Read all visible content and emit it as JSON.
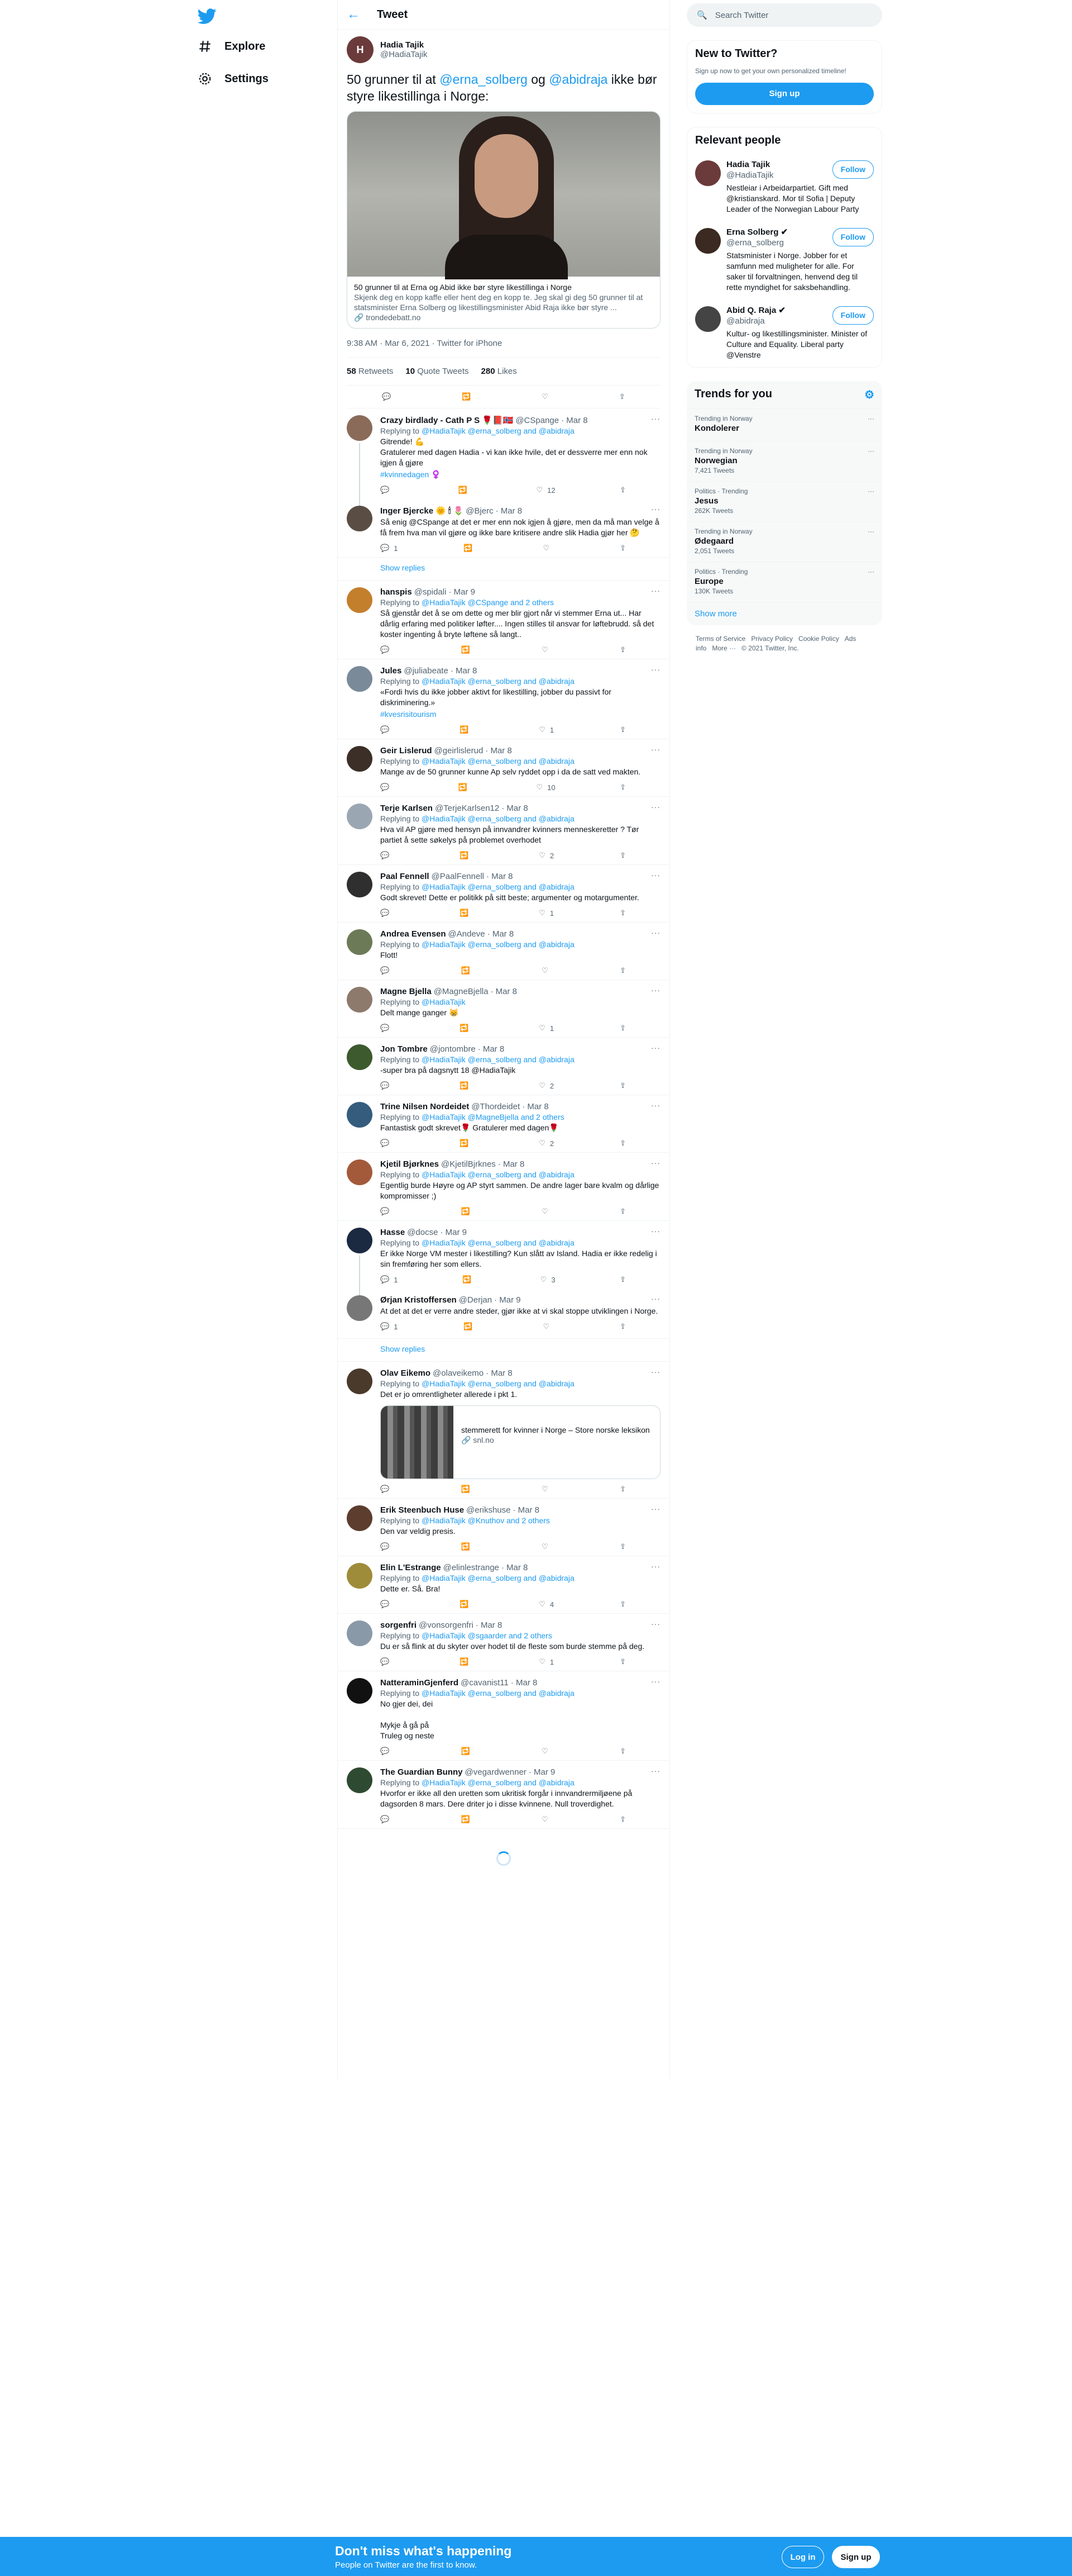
{
  "nav": {
    "explore": "Explore",
    "settings": "Settings"
  },
  "header": {
    "title": "Tweet"
  },
  "focal": {
    "name": "Hadia Tajik",
    "handle": "@HadiaTajik",
    "text_before": "50 grunner til at ",
    "mention1": "@erna_solberg",
    "text_mid": " og ",
    "mention2": "@abidraja",
    "text_after": " ikke bør styre likestillinga i Norge:",
    "card_title": "50 grunner til at Erna og Abid ikke bør styre likestillinga i Norge",
    "card_desc": "Skjenk deg en kopp kaffe eller hent deg en kopp te. Jeg skal gi deg 50 grunner til at statsminister Erna Solberg og likestillingsminister Abid Raja ikke bør styre ...",
    "card_domain": "🔗 trondedebatt.no",
    "meta": "9:38 AM · Mar 6, 2021 · Twitter for iPhone",
    "retweets": "58",
    "retweets_label": "Retweets",
    "quotes": "10",
    "quotes_label": "Quote Tweets",
    "likes": "280",
    "likes_label": "Likes"
  },
  "replies": [
    {
      "name": "Crazy birdlady - Cath P S 🌹📕🇳🇴",
      "handle": "@CSpange",
      "date": "· Mar 8",
      "rto": "@HadiaTajik @erna_solberg and @abidraja",
      "text": "Gitrende! 💪\nGratulerer med dagen Hadia - vi kan ikke hvile, det er  dessverre mer enn nok igjen å gjøre",
      "tag": "#kvinnedagen ♀️",
      "c": "",
      "r": "",
      "l": "12",
      "av": "#8a6b5a",
      "thread": true
    },
    {
      "name": "Inger Bjercke 🌞 🕯 🌷",
      "handle": "@Bjerc",
      "date": "· Mar 8",
      "rto": "",
      "text": "Så enig @CSpange at det er mer enn nok igjen å gjøre, men da må man velge å få frem hva man vil gjøre og ikke bare kritisere andre slik Hadia gjør her 🤔",
      "tag": "",
      "c": "1",
      "r": "",
      "l": "",
      "av": "#5a4e44",
      "thread": false
    },
    {
      "name": "hanspis",
      "handle": "@spidali",
      "date": "· Mar 9",
      "rto": "@HadiaTajik @CSpange and 2 others",
      "text": "Så gjenstår det å se om dette og mer blir gjort når vi stemmer Erna ut... Har dårlig erfaring med politiker løfter.... Ingen stilles til ansvar for løftebrudd. så det koster ingenting å bryte løftene så langt..",
      "tag": "",
      "c": "",
      "r": "",
      "l": "",
      "av": "#c47f2c",
      "thread": false
    },
    {
      "name": "Jules",
      "handle": "@juliabeate",
      "date": "· Mar 8",
      "rto": "@HadiaTajik @erna_solberg and @abidraja",
      "text": "«Fordi hvis du ikke jobber aktivt for likestilling, jobber du passivt for diskriminering.»",
      "tag": "#kvesrisitourism",
      "c": "",
      "r": "",
      "l": "1",
      "av": "#7a8a99",
      "thread": false
    },
    {
      "name": "Geir Lislerud",
      "handle": "@geirlislerud",
      "date": "· Mar 8",
      "rto": "@HadiaTajik @erna_solberg and @abidraja",
      "text": "Mange av de 50 grunner kunne Ap selv ryddet opp i da de satt ved makten.",
      "tag": "",
      "c": "",
      "r": "",
      "l": "10",
      "av": "#3b2f28",
      "thread": false
    },
    {
      "name": "Terje Karlsen",
      "handle": "@TerjeKarlsen12",
      "date": "· Mar 8",
      "rto": "@HadiaTajik @erna_solberg and @abidraja",
      "text": "Hva vil AP gjøre med hensyn på innvandrer kvinners menneskeretter ? Tør partiet å sette søkelys på problemet overhodet",
      "tag": "",
      "c": "",
      "r": "",
      "l": "2",
      "av": "#9aa7b3",
      "thread": false
    },
    {
      "name": "Paal Fennell",
      "handle": "@PaalFennell",
      "date": "· Mar 8",
      "rto": "@HadiaTajik @erna_solberg and @abidraja",
      "text": "Godt skrevet! Dette er politikk på sitt beste; argumenter og motargumenter.",
      "tag": "",
      "c": "",
      "r": "",
      "l": "1",
      "av": "#2f2f2f",
      "thread": false
    },
    {
      "name": "Andrea Evensen",
      "handle": "@Andeve",
      "date": "· Mar 8",
      "rto": "@HadiaTajik @erna_solberg and @abidraja",
      "text": "Flott!",
      "tag": "",
      "c": "",
      "r": "",
      "l": "",
      "av": "#6d7a57",
      "thread": false
    },
    {
      "name": "Magne Bjella",
      "handle": "@MagneBjella",
      "date": "· Mar 8",
      "rto": "@HadiaTajik",
      "text": "Delt mange ganger 😸",
      "tag": "",
      "c": "",
      "r": "",
      "l": "1",
      "av": "#8d7a6c",
      "thread": false
    },
    {
      "name": "Jon Tombre",
      "handle": "@jontombre",
      "date": "· Mar 8",
      "rto": "@HadiaTajik @erna_solberg and @abidraja",
      "text": "-super bra på dagsnytt 18 @HadiaTajik",
      "tag": "",
      "c": "",
      "r": "",
      "l": "2",
      "av": "#3d5a2e",
      "thread": false
    },
    {
      "name": "Trine Nilsen Nordeidet",
      "handle": "@Thordeidet",
      "date": "· Mar 8",
      "rto": "@HadiaTajik @MagneBjella and 2 others",
      "text": "Fantastisk godt skrevet🌹 Gratulerer med dagen🌹",
      "tag": "",
      "c": "",
      "r": "",
      "l": "2",
      "av": "#355c7d",
      "thread": false
    },
    {
      "name": "Kjetil Bjørknes",
      "handle": "@KjetilBjrknes",
      "date": "· Mar 8",
      "rto": "@HadiaTajik @erna_solberg and @abidraja",
      "text": "Egentlig burde Høyre og AP styrt sammen. De andre lager bare kvalm og dårlige kompromisser ;)",
      "tag": "",
      "c": "",
      "r": "",
      "l": "",
      "av": "#a35a3a",
      "thread": false
    },
    {
      "name": "Hasse",
      "handle": "@docse",
      "date": "· Mar 9",
      "rto": "@HadiaTajik @erna_solberg and @abidraja",
      "text": "Er ikke Norge VM mester i likestilling? Kun slått av Island. Hadia er ikke redelig i sin fremføring her som ellers.",
      "tag": "",
      "c": "1",
      "r": "",
      "l": "3",
      "av": "#1b2a41",
      "thread": true
    },
    {
      "name": "Ørjan Kristoffersen",
      "handle": "@Derjan",
      "date": "· Mar 9",
      "rto": "",
      "text": "At det at det er verre andre steder, gjør ikke at vi skal stoppe utviklingen i Norge.",
      "tag": "",
      "c": "1",
      "r": "",
      "l": "",
      "av": "#777",
      "thread": false
    },
    {
      "name": "Olav Eikemo",
      "handle": "@olaveikemo",
      "date": "· Mar 8",
      "rto": "@HadiaTajik @erna_solberg and @abidraja",
      "text": "Det er jo omrentligheter allerede i pkt 1.",
      "tag": "",
      "c": "",
      "r": "",
      "l": "",
      "av": "#4a3a2c",
      "thread": false
    },
    {
      "name": "Erik Steenbuch Huse",
      "handle": "@erikshuse",
      "date": "· Mar 8",
      "rto": "@HadiaTajik @Knuthov and 2 others",
      "text": "Den var veldig presis.",
      "tag": "",
      "c": "",
      "r": "",
      "l": "",
      "av": "#5c3d2e",
      "thread": false
    },
    {
      "name": "Elin L'Estrange",
      "handle": "@elinlestrange",
      "date": "· Mar 8",
      "rto": "@HadiaTajik @erna_solberg and @abidraja",
      "text": "Dette er. Så. Bra!",
      "tag": "",
      "c": "",
      "r": "",
      "l": "4",
      "av": "#9e8c3a",
      "thread": false
    },
    {
      "name": "sorgenfri",
      "handle": "@vonsorgenfri",
      "date": "· Mar 8",
      "rto": "@HadiaTajik @sgaarder and 2 others",
      "text": "Du er så flink at du skyter over hodet til de fleste som burde stemme på deg.",
      "tag": "",
      "c": "",
      "r": "",
      "l": "1",
      "av": "#8a99a8",
      "thread": false
    },
    {
      "name": "NatteraminGjenferd",
      "handle": "@cavanist11",
      "date": "· Mar 8",
      "rto": "@HadiaTajik @erna_solberg and @abidraja",
      "text": "No gjer dei, dei\n\nMykje å gå på\nTruleg og neste",
      "tag": "",
      "c": "",
      "r": "",
      "l": "",
      "av": "#111",
      "thread": false
    },
    {
      "name": "The Guardian Bunny",
      "handle": "@vegardwenner",
      "date": "· Mar 9",
      "rto": "@HadiaTajik @erna_solberg and @abidraja",
      "text": "Hvorfor er ikke all den uretten som ukritisk forgår i innvandrermiljøene på dagsorden 8 mars. Dere driter jo i disse kvinnene. Null troverdighet.",
      "tag": "",
      "c": "",
      "r": "",
      "l": "",
      "av": "#2e4a30",
      "thread": false
    }
  ],
  "show_replies": "Show replies",
  "olav_card": {
    "title": "stemmerett for kvinner i Norge – Store norske leksikon",
    "domain": "🔗 snl.no"
  },
  "right": {
    "search_placeholder": "Search Twitter",
    "new_title": "New to Twitter?",
    "new_sub": "Sign up now to get your own personalized timeline!",
    "signup": "Sign up",
    "people_title": "Relevant people",
    "people": [
      {
        "name": "Hadia Tajik",
        "handle": "@HadiaTajik",
        "bio": "Nestleiar i Arbeidarpartiet. Gift med @kristianskard. Mor til Sofia | Deputy Leader of the Norwegian Labour Party",
        "follow": "Follow",
        "av": "#6b3a3a"
      },
      {
        "name": "Erna Solberg ✔",
        "handle": "@erna_solberg",
        "bio": "Statsminister i Norge. Jobber for et samfunn med muligheter for alle. For saker til forvaltningen, henvend deg til rette myndighet for saksbehandling.",
        "follow": "Follow",
        "av": "#3a2a22"
      },
      {
        "name": "Abid Q. Raja ✔",
        "handle": "@abidraja",
        "bio": "Kultur- og likestillingsminister. Minister of Culture and Equality. Liberal party @Venstre",
        "follow": "Follow",
        "av": "#444"
      }
    ],
    "trends_title": "Trends for you",
    "trends": [
      {
        "ctx": "Trending in Norway",
        "name": "Kondolerer",
        "count": ""
      },
      {
        "ctx": "Trending in Norway",
        "name": "Norwegian",
        "count": "7,421 Tweets"
      },
      {
        "ctx": "Politics · Trending",
        "name": "Jesus",
        "count": "262K Tweets"
      },
      {
        "ctx": "Trending in Norway",
        "name": "Ødegaard",
        "count": "2,051 Tweets"
      },
      {
        "ctx": "Politics · Trending",
        "name": "Europe",
        "count": "130K Tweets"
      }
    ],
    "show_more": "Show more",
    "footer": [
      "Terms of Service",
      "Privacy Policy",
      "Cookie Policy",
      "Ads info",
      "More ···",
      "© 2021 Twitter, Inc."
    ]
  },
  "bottom": {
    "title": "Don't miss what's happening",
    "sub": "People on Twitter are the first to know.",
    "login": "Log in",
    "signup": "Sign up"
  }
}
